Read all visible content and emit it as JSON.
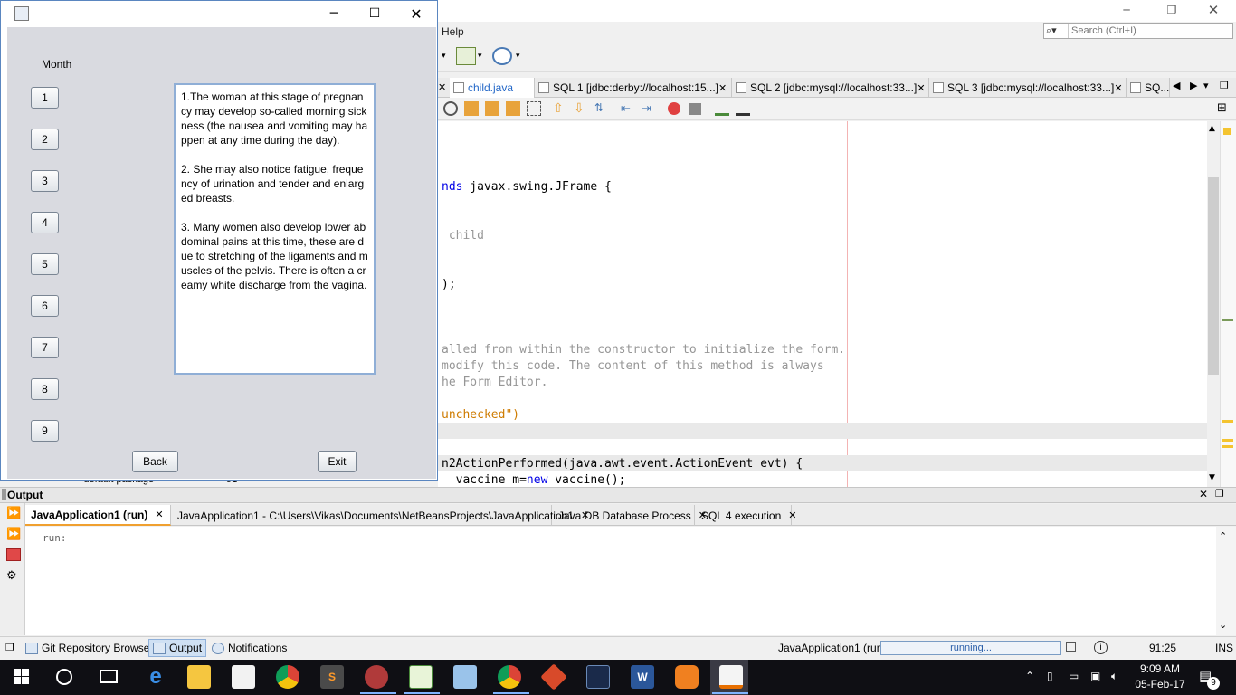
{
  "netbeans": {
    "menu_help": "Help",
    "search_placeholder": "Search (Ctrl+I)",
    "editor_tabs": [
      {
        "label": "child.java",
        "active": true
      },
      {
        "label": "SQL 1 [jdbc:derby://localhost:15...]",
        "active": false
      },
      {
        "label": "SQL 2 [jdbc:mysql://localhost:33...]",
        "active": false
      },
      {
        "label": "SQL 3 [jdbc:mysql://localhost:33...]",
        "active": false
      },
      {
        "label": "SQ...",
        "active": false
      }
    ],
    "code": {
      "line1_kw": "nds",
      "line1_rest": " javax.swing.JFrame {",
      "line2": " child",
      "line3": ");",
      "line4": "alled from within the constructor to initialize the form.",
      "line5": "modify this code. The content of this method is always",
      "line6": "he Form Editor.",
      "line7": "unchecked\")",
      "line8": "n2ActionPerformed(java.awt.event.ActionEvent evt) {",
      "line9_pre": "  vaccine m=",
      "line9_kw": "new",
      "line9_post": " vaccine();",
      "package_fragment": "<default package>",
      "line_no_fragment": "91"
    },
    "output": {
      "title": "Output",
      "tabs": [
        {
          "label": "JavaApplication1 (run)",
          "active": true
        },
        {
          "label": "JavaApplication1 - C:\\Users\\Vikas\\Documents\\NetBeansProjects\\JavaApplication1",
          "active": false
        },
        {
          "label": "Java DB Database Process",
          "active": false
        },
        {
          "label": "SQL 4 execution",
          "active": false
        }
      ],
      "console_text": "run:"
    },
    "statusbar": {
      "git": "Git Repository Browser",
      "output": "Output",
      "notifications": "Notifications",
      "running_app": "JavaApplication1 (run)",
      "progress_text": "running...",
      "position": "91:25",
      "mode": "INS"
    }
  },
  "dialog": {
    "month_label": "Month",
    "month_buttons": [
      "1",
      "2",
      "3",
      "4",
      "5",
      "6",
      "7",
      "8",
      "9"
    ],
    "info_text": "1.The woman at this stage of pregnancy may develop so-called morning sickness (the nausea and vomiting may happen at any time during the day).\n\n2. She may also notice fatigue, frequency of urination and tender and enlarged breasts.\n\n3. Many women also develop lower abdominal pains at this time, these are due to stretching of the ligaments and muscles of the pelvis. There is often a creamy white discharge from the vagina.",
    "back_label": "Back",
    "exit_label": "Exit"
  },
  "taskbar": {
    "time": "9:09 AM",
    "date": "05-Feb-17",
    "notification_count": "9",
    "apps": [
      "edge-icon",
      "file-explorer-icon",
      "store-icon",
      "chrome-icon",
      "sublime-icon",
      "tool-icon",
      "spreadsheet-icon",
      "box-icon",
      "chrome-icon",
      "git-icon",
      "mysql-icon",
      "word-icon",
      "app-icon",
      "java-icon"
    ]
  },
  "colors": {
    "accent": "#2468c8",
    "dialog_bg": "#d9dae0",
    "taskbar_bg": "#0f0f14",
    "info_border": "#8faed6"
  }
}
